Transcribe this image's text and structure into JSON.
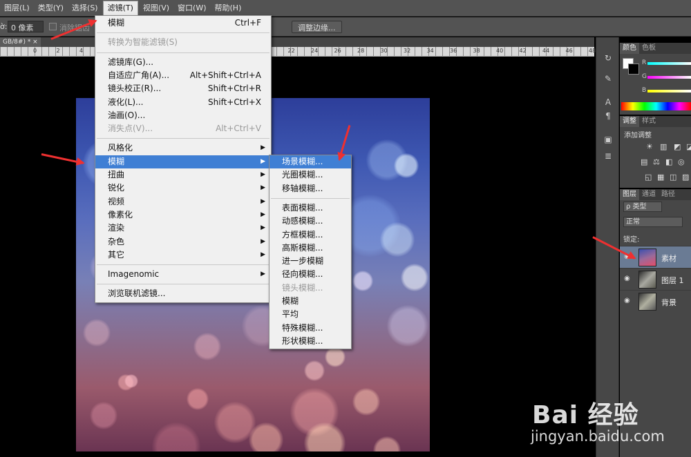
{
  "menubar": [
    "图层(L)",
    "类型(Y)",
    "选择(S)",
    "滤镜(T)",
    "视图(V)",
    "窗口(W)",
    "帮助(H)"
  ],
  "options": {
    "feather_label": "ờ:",
    "feather_value": "0 像素",
    "antialias_label": "消除锯齿",
    "refine_button": "调整边缘..."
  },
  "doc_tab": "GB/8#) *  ×",
  "ruler_ticks": [
    "0",
    "2",
    "4",
    "6",
    "8",
    "10",
    "12",
    "14",
    "16",
    "18",
    "20",
    "22",
    "24",
    "26",
    "28",
    "30",
    "32",
    "34",
    "36",
    "38",
    "40",
    "42",
    "44",
    "46",
    "48"
  ],
  "filter_menu": [
    {
      "label": "模糊",
      "shortcut": "Ctrl+F",
      "state": "normal"
    },
    {
      "sep": true
    },
    {
      "label": "转换为智能滤镜(S)",
      "shortcut": "",
      "state": "disabled"
    },
    {
      "sep": true
    },
    {
      "label": "滤镜库(G)...",
      "shortcut": "",
      "state": "normal"
    },
    {
      "label": "自适应广角(A)...",
      "shortcut": "Alt+Shift+Ctrl+A",
      "state": "normal"
    },
    {
      "label": "镜头校正(R)...",
      "shortcut": "Shift+Ctrl+R",
      "state": "normal"
    },
    {
      "label": "液化(L)...",
      "shortcut": "Shift+Ctrl+X",
      "state": "normal"
    },
    {
      "label": "油画(O)...",
      "shortcut": "",
      "state": "normal"
    },
    {
      "label": "消失点(V)...",
      "shortcut": "Alt+Ctrl+V",
      "state": "disabled"
    },
    {
      "sep": true
    },
    {
      "label": "风格化",
      "sub": true,
      "state": "normal"
    },
    {
      "label": "模糊",
      "sub": true,
      "state": "highlight"
    },
    {
      "label": "扭曲",
      "sub": true,
      "state": "normal"
    },
    {
      "label": "锐化",
      "sub": true,
      "state": "normal"
    },
    {
      "label": "视频",
      "sub": true,
      "state": "normal"
    },
    {
      "label": "像素化",
      "sub": true,
      "state": "normal"
    },
    {
      "label": "渲染",
      "sub": true,
      "state": "normal"
    },
    {
      "label": "杂色",
      "sub": true,
      "state": "normal"
    },
    {
      "label": "其它",
      "sub": true,
      "state": "normal"
    },
    {
      "sep": true
    },
    {
      "label": "Imagenomic",
      "sub": true,
      "state": "normal"
    },
    {
      "sep": true
    },
    {
      "label": "浏览联机滤镜...",
      "shortcut": "",
      "state": "normal"
    }
  ],
  "blur_submenu": [
    {
      "label": "场景模糊...",
      "state": "highlight"
    },
    {
      "label": "光圈模糊...",
      "state": "normal"
    },
    {
      "label": "移轴模糊...",
      "state": "normal"
    },
    {
      "sep": true
    },
    {
      "label": "表面模糊...",
      "state": "normal"
    },
    {
      "label": "动感模糊...",
      "state": "normal"
    },
    {
      "label": "方框模糊...",
      "state": "normal"
    },
    {
      "label": "高斯模糊...",
      "state": "normal"
    },
    {
      "label": "进一步模糊",
      "state": "normal"
    },
    {
      "label": "径向模糊...",
      "state": "normal"
    },
    {
      "label": "镜头模糊...",
      "state": "disabled"
    },
    {
      "label": "模糊",
      "state": "normal"
    },
    {
      "label": "平均",
      "state": "normal"
    },
    {
      "label": "特殊模糊...",
      "state": "normal"
    },
    {
      "label": "形状模糊...",
      "state": "normal"
    }
  ],
  "color_panel": {
    "tabs": [
      "颜色",
      "色板"
    ],
    "r": "R",
    "g": "G",
    "b": "B"
  },
  "adjust_panel": {
    "tabs": [
      "调整",
      "样式"
    ],
    "title": "添加调整"
  },
  "layers_panel": {
    "tabs": [
      "图层",
      "通道",
      "路径"
    ],
    "kind": "ρ 类型",
    "blend": "正常",
    "lock": "锁定:",
    "layers": [
      {
        "name": "素材",
        "selected": true
      },
      {
        "name": "图层 1",
        "selected": false
      },
      {
        "name": "背景",
        "selected": false
      }
    ]
  },
  "watermark": {
    "brand": "Bai 经验",
    "url": "jingyan.baidu.com"
  },
  "colors": {
    "menubar": "#535353",
    "highlight": "#3f7fd4",
    "arrow": "#ef3030"
  }
}
